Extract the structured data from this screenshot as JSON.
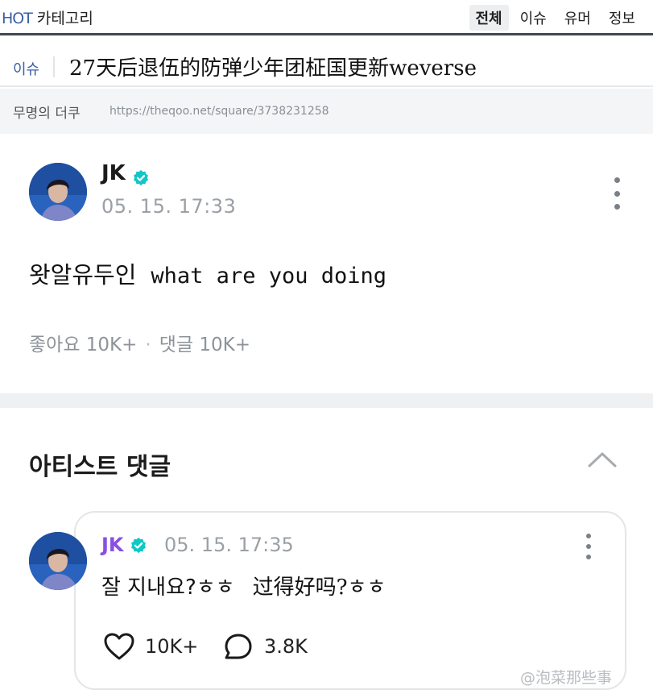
{
  "nav": {
    "brand_hot": "HOT",
    "brand_label": "카테고리",
    "tabs": [
      "전체",
      "이슈",
      "유머",
      "정보"
    ],
    "active_tab": "전체"
  },
  "article": {
    "category": "이슈",
    "title": "27天后退伍的防弹少年团柾国更新weverse",
    "author": "무명의 더쿠",
    "url": "https://theqoo.net/square/3738231258"
  },
  "post": {
    "name": "JK",
    "time": "05. 15. 17:33",
    "body_ko": "왓알유두인",
    "body_en": "what are you doing",
    "likes_label": "좋아요 10K+",
    "separator": "·",
    "comments_label": "댓글 10K+"
  },
  "artist_comments": {
    "section_title": "아티스트 댓글",
    "comment": {
      "name": "JK",
      "time": "05. 15. 17:35",
      "body_ko": "잘 지내요?ㅎㅎ",
      "body_cn": "过得好吗?ㅎㅎ",
      "likes": "10K+",
      "replies": "3.8K"
    }
  },
  "watermark": "@泡菜那些事",
  "colors": {
    "accent_blue": "#3a5fa8",
    "verified_badge": "#12c6c6",
    "artist_name_purple": "#8a4fe0",
    "muted_gray": "#9aa0a6"
  },
  "icons": [
    "verified-badge-icon",
    "more-vertical-icon",
    "chevron-up-icon",
    "heart-icon",
    "comment-bubble-icon"
  ]
}
